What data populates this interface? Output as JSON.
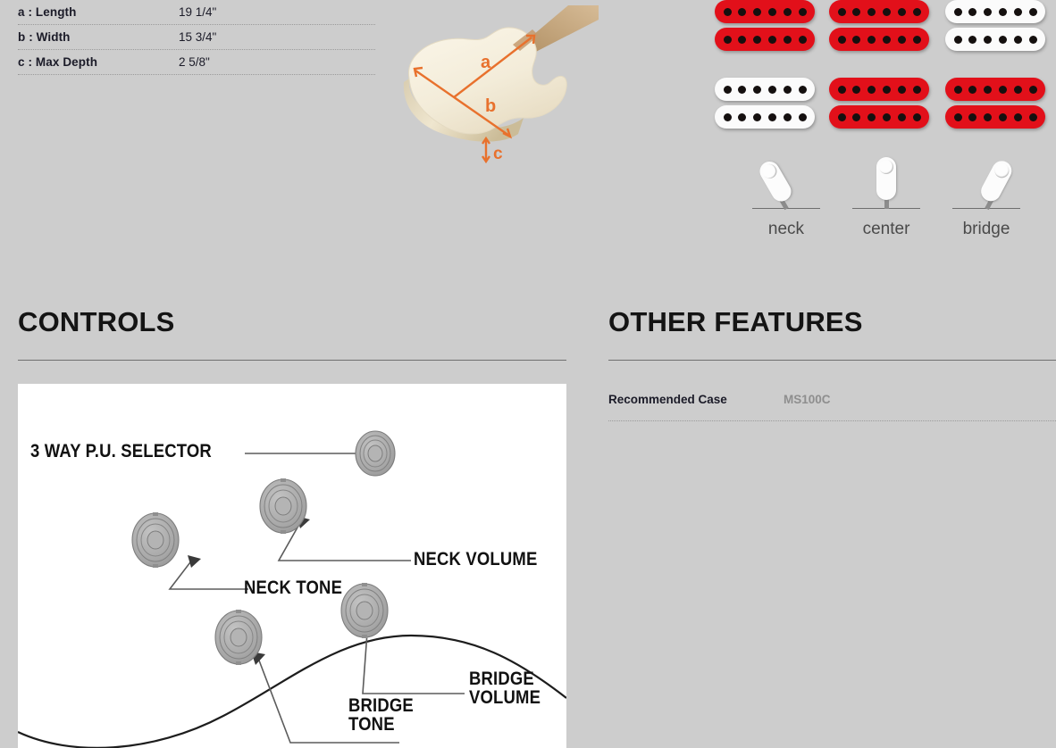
{
  "dimensions": {
    "rows": [
      {
        "label": "a : Length",
        "value": "19 1/4\""
      },
      {
        "label": "b : Width",
        "value": "15 3/4\""
      },
      {
        "label": "c : Max Depth",
        "value": "2 5/8\""
      }
    ]
  },
  "body_figure": {
    "alt": "guitar body case 3d illustration",
    "callouts": [
      "a",
      "b",
      "c"
    ],
    "arrow_color": "#e8712d",
    "body_color": "#f2ecdc",
    "neck_color": "#c9a274"
  },
  "pickups": {
    "grid": [
      {
        "color": "red",
        "poles": 6
      },
      {
        "color": "red",
        "poles": 6
      },
      {
        "color": "white",
        "poles": 6
      },
      {
        "color": "white",
        "poles": 6
      },
      {
        "color": "red",
        "poles": 6
      },
      {
        "color": "red",
        "poles": 6
      }
    ],
    "red_hex": "#e2101a",
    "white_hex": "#fbfbfb"
  },
  "switch_positions": [
    {
      "label": "neck",
      "angle": -32
    },
    {
      "label": "center",
      "angle": 0
    },
    {
      "label": "bridge",
      "angle": 30
    }
  ],
  "sections": {
    "controls": {
      "title": "CONTROLS"
    },
    "other_features": {
      "title": "OTHER FEATURES"
    }
  },
  "other_features": {
    "rows": [
      {
        "label": "Recommended Case",
        "value": "MS100C"
      }
    ]
  },
  "controls_diagram": {
    "labels": [
      {
        "text": "3 WAY P.U. SELECTOR"
      },
      {
        "text": "NECK VOLUME"
      },
      {
        "text": "NECK TONE"
      },
      {
        "text": "BRIDGE\nVOLUME"
      },
      {
        "text": "BRIDGE\nTONE"
      }
    ],
    "knob_count": 5,
    "knob_color": "#a8a8a8"
  }
}
